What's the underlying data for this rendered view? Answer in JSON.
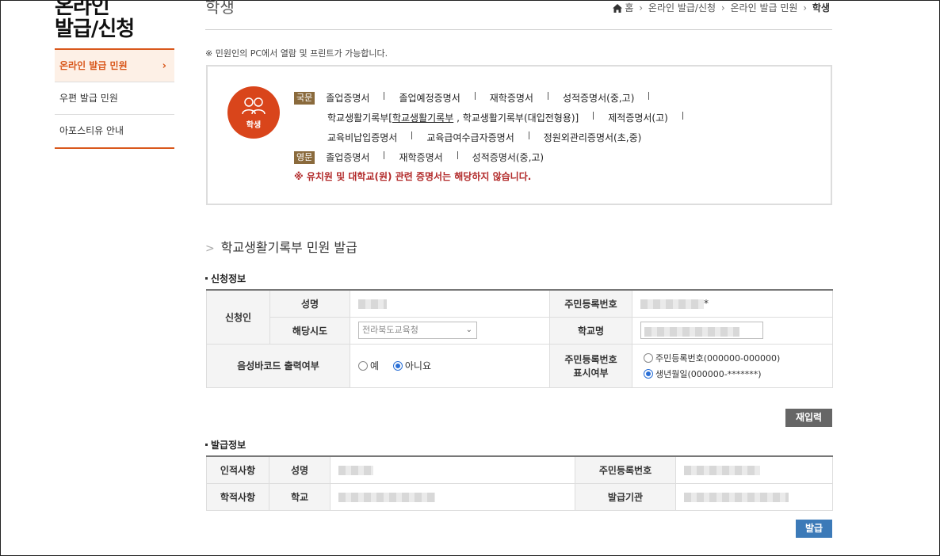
{
  "sidebar": {
    "title_line1": "온라인",
    "title_line2": "발급/신청",
    "items": [
      {
        "label": "온라인 발급 민원",
        "chevron": "›"
      },
      {
        "label": "우편 발급 민원"
      },
      {
        "label": "아포스티유 안내"
      }
    ]
  },
  "header": {
    "title": "학생",
    "breadcrumb": [
      "홈",
      "온라인 발급/신청",
      "온라인 발급 민원",
      "학생"
    ],
    "breadcrumb_sep": "›"
  },
  "notice": "※ 민원인의 PC에서 열람 및 프린트가 가능합니다.",
  "certificates": {
    "icon_label": "학생",
    "korean_tag": "국문",
    "english_tag": "영문",
    "row1": [
      "졸업증명서",
      "졸업예정증명서",
      "재학증명서",
      "성적증명서(중,고)"
    ],
    "row2_a": "학교생활기록부[",
    "row2_link": "학교생활기록부",
    "row2_b": " , 학교생활기록부(대입전형용)]",
    "row2_c": "제적증명서(고)",
    "row3": [
      "교육비납입증명서",
      "교육급여수급자증명서",
      "정원외관리증명서(초,중)"
    ],
    "row4": [
      "졸업증명서",
      "재학증명서",
      "성적증명서(중,고)"
    ],
    "warning": "※ 유치원 및 대학교(원) 관련 증명서는 해당하지 않습니다."
  },
  "section_title": "학교생활기록부 민원 발급",
  "apply_info": {
    "heading": "신청정보",
    "applicant": "신청인",
    "name_label": "성명",
    "ssn_label": "주민등록번호",
    "ssn_suffix": "*",
    "region_label": "해당시도",
    "region_value": "전라북도교육청",
    "school_label": "학교명",
    "voice_label": "음성바코드 출력여부",
    "voice_yes": "예",
    "voice_no": "아니요",
    "voice_selected": "아니요",
    "ssn_display_label_1": "주민등록번호",
    "ssn_display_label_2": "표시여부",
    "ssn_opt1": "주민등록번호(000000-000000)",
    "ssn_opt2": "생년월일(000000-*******)",
    "ssn_selected": "생년월일(000000-*******)"
  },
  "reset_button": "재입력",
  "issue_info": {
    "heading": "발급정보",
    "personal": "인적사항",
    "name_label": "성명",
    "ssn_label": "주민등록번호",
    "academic": "학적사항",
    "school_label": "학교",
    "agency_label": "발급기관"
  },
  "issue_button": "발급",
  "colors": {
    "accent": "#d9581c",
    "issue_button": "#3c7ab8",
    "warning": "#b22a2a"
  }
}
